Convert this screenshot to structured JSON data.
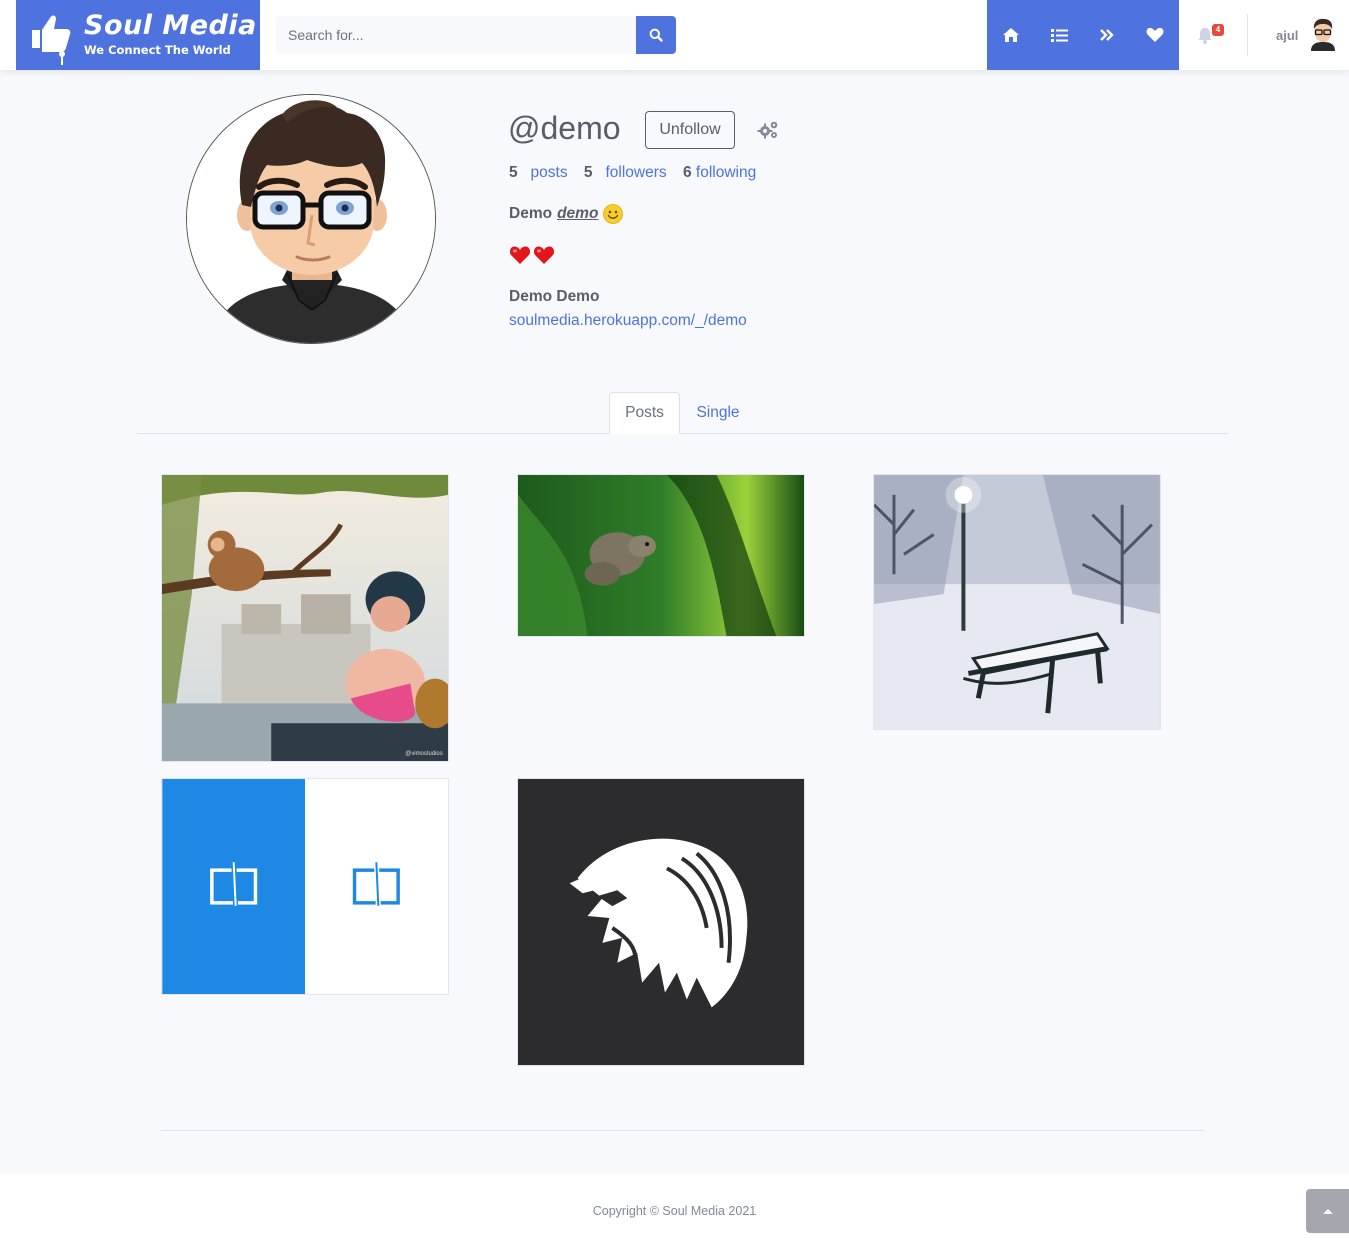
{
  "brand": {
    "name": "Soul Media",
    "tagline": "We Connect The World"
  },
  "search": {
    "placeholder": "Search for...",
    "value": ""
  },
  "nav": {
    "icons": [
      "home-icon",
      "list-icon",
      "double-angle-right-icon",
      "heart-icon"
    ],
    "notifications": {
      "icon": "bell-icon",
      "count": "4"
    },
    "user": {
      "name": "ajul"
    }
  },
  "profile": {
    "username": "@demo",
    "follow_button": "Unfollow",
    "settings_icon": "cogs-icon",
    "stats": {
      "posts_count": "5",
      "posts_label": "posts",
      "followers_count": "5",
      "followers_label": "followers",
      "following_count": "6",
      "following_label": "following"
    },
    "bio": {
      "name_part": "Demo",
      "handle_part": "demo",
      "emoji": "smiley-icon",
      "hearts": [
        "heart-emoji-icon",
        "heart-emoji-icon"
      ]
    },
    "full_name": "Demo Demo",
    "link": "soulmedia.herokuapp.com/_/demo"
  },
  "tabs": [
    {
      "label": "Posts",
      "active": true
    },
    {
      "label": "Single",
      "active": false
    }
  ],
  "posts": [
    {
      "subject": "monkey and child deity artwork",
      "caption": "@vimostudios"
    },
    {
      "subject": "squirrel in green foliage"
    },
    {
      "subject": "snowy park bench with lamp"
    },
    {
      "subject": "blue and white book logo"
    },
    {
      "subject": "white lion head on dark background"
    }
  ],
  "footer": {
    "copyright": "Copyright © Soul Media 2021",
    "scroll_top_icon": "angle-up-icon"
  },
  "colors": {
    "primary": "#4e73df",
    "background": "#f8f9fc",
    "text": "#5a5c69",
    "badge": "#e74a3b"
  }
}
